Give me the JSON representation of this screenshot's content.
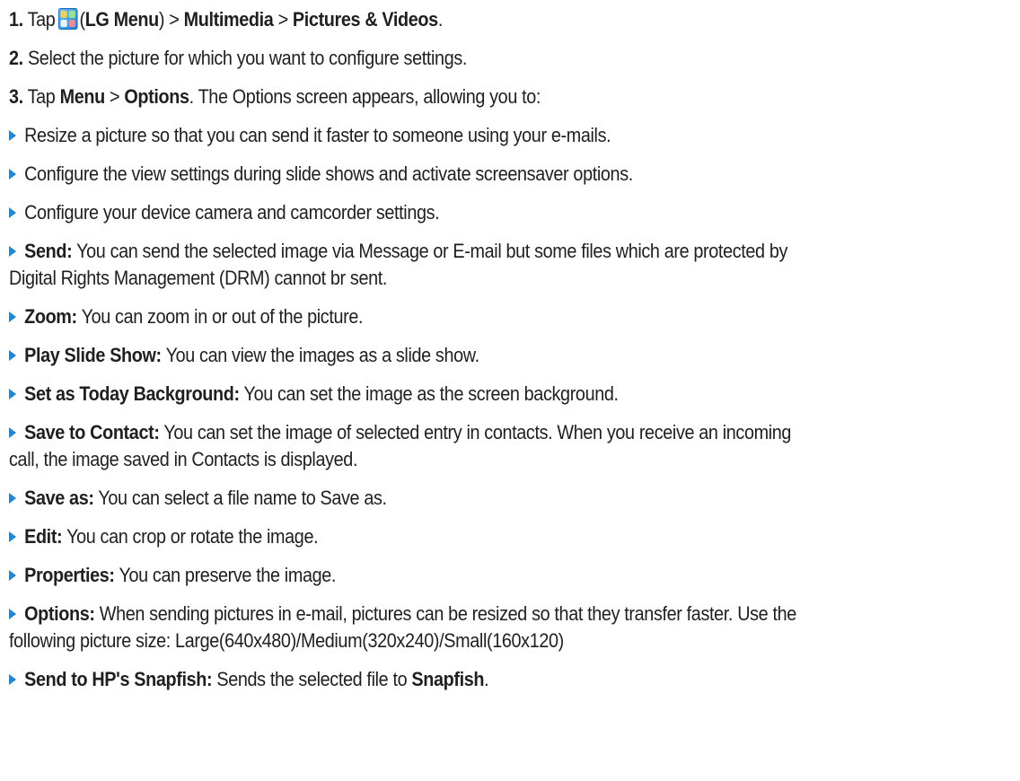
{
  "steps": [
    {
      "num": "1.",
      "pre": "Tap",
      "lg_menu": "LG Menu",
      "sep1": ">",
      "multimedia": "Multimedia",
      "sep2": ">",
      "pictures": "Pictures & Videos",
      "end": "."
    },
    {
      "num": "2.",
      "text": "Select the picture for which you want to configure settings."
    },
    {
      "num": "3.",
      "pre": "Tap",
      "menu": "Menu",
      "sep": ">",
      "options": "Options",
      "post": ". The Options screen appears, allowing you to:"
    }
  ],
  "intro_bullets": [
    "Resize a picture so that you can send it faster to someone using your e-mails.",
    "Configure the view settings during slide shows and activate screensaver options.",
    "Configure your device camera and camcorder settings."
  ],
  "option_items": [
    {
      "term": "Send:",
      "desc": " You can send the selected image via Message or E-mail but some files which are protected by",
      "desc2": "Digital Rights Management (DRM) cannot br sent."
    },
    {
      "term": "Zoom:",
      "desc": " You can zoom in or out of the picture."
    },
    {
      "term": "Play Slide Show:",
      "desc": " You can view the images as a slide show."
    },
    {
      "term": "Set as Today Background:",
      "desc": " You can set the image as the screen background."
    },
    {
      "term": "Save to Contact:",
      "desc": " You can set the image of selected entry in contacts. When you receive an incoming",
      "desc2": "call, the image saved in Contacts is displayed."
    },
    {
      "term": "Save as:",
      "desc": " You can select a file name to Save as."
    },
    {
      "term": "Edit:",
      "desc": " You can crop or rotate the image."
    },
    {
      "term": "Properties:",
      "desc": " You can preserve the image."
    },
    {
      "term": "Options:",
      "desc": " When sending pictures in e-mail, pictures can be resized so that they transfer faster. Use the",
      "desc2": "following picture size: Large(640x480)/Medium(320x240)/Small(160x120)"
    },
    {
      "term": "Send to HP's Snapfish:",
      "desc": " Sends the selected file to ",
      "desc_bold": "Snapfish",
      "desc_end": "."
    }
  ],
  "colors": {
    "bullet": "#1e88d6",
    "text": "#1f1f1f"
  },
  "icons": {
    "lg_menu": "lg-menu-icon",
    "bullet": "triangle-bullet-icon"
  }
}
